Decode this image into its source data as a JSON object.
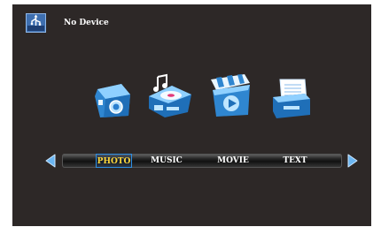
{
  "device": {
    "label": "No Device",
    "icon": "usb-icon"
  },
  "apps": [
    {
      "name": "photo",
      "icon": "camera-icon"
    },
    {
      "name": "music",
      "icon": "music-player-icon"
    },
    {
      "name": "movie",
      "icon": "clapperboard-icon"
    },
    {
      "name": "text",
      "icon": "document-tray-icon"
    }
  ],
  "tabs": [
    {
      "label": "PHOTO",
      "selected": true
    },
    {
      "label": "MUSIC",
      "selected": false
    },
    {
      "label": "MOVIE",
      "selected": false
    },
    {
      "label": "TEXT",
      "selected": false
    }
  ],
  "colors": {
    "background": "#2d2827",
    "accent": "#2f8fe0",
    "selected_text": "#ffd83a",
    "text": "#ffffff"
  }
}
